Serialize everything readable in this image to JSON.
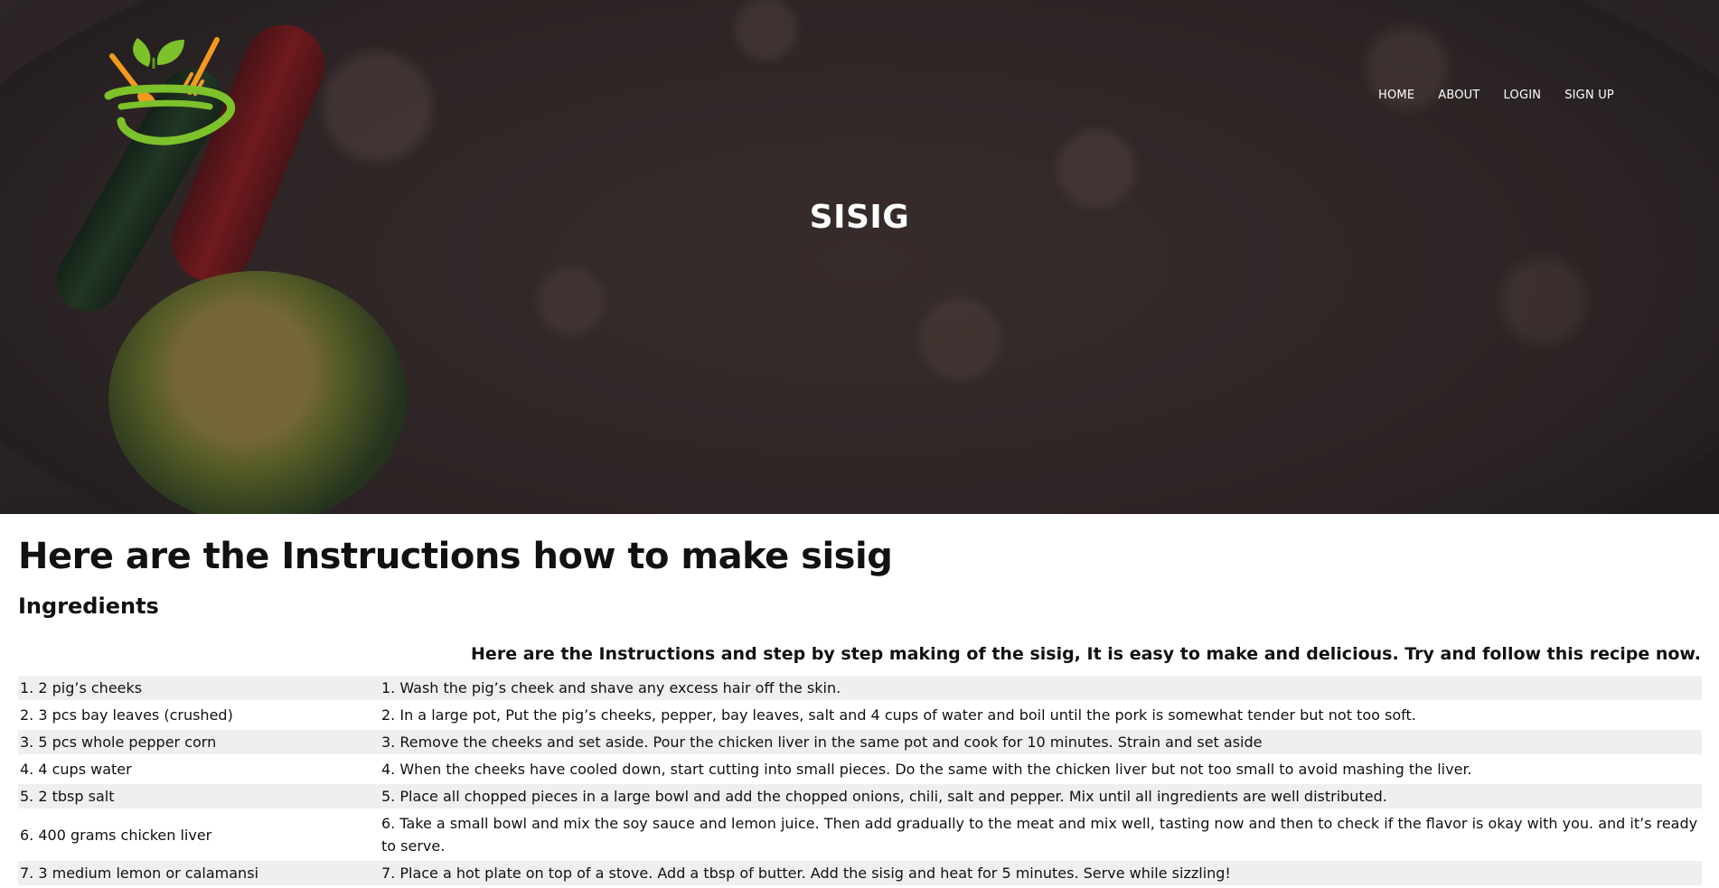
{
  "nav": {
    "items": [
      "HOME",
      "ABOUT",
      "LOGIN",
      "SIGN UP"
    ]
  },
  "hero": {
    "title": "SISIG"
  },
  "page": {
    "heading": "Here are the Instructions how to make sisig",
    "subheading": "Ingredients",
    "lead": "Here are the Instructions and step by step making of the sisig, It is easy to make and delicious. Try and follow this recipe now."
  },
  "table": {
    "rows": [
      {
        "ingredient": "1. 2 pig’s cheeks",
        "step": "1. Wash the pig’s cheek and shave any excess hair off the skin."
      },
      {
        "ingredient": "2. 3 pcs bay leaves (crushed)",
        "step": "2. In a large pot, Put the pig’s cheeks, pepper, bay leaves, salt and 4 cups of water and boil until the pork is somewhat tender but not too soft."
      },
      {
        "ingredient": "3. 5 pcs whole pepper corn",
        "step": "3. Remove the cheeks and set aside. Pour the chicken liver in the same pot and cook for 10 minutes. Strain and set aside"
      },
      {
        "ingredient": "4. 4 cups water",
        "step": "4. When the cheeks have cooled down, start cutting into small pieces. Do the same with the chicken liver but not too small to avoid mashing the liver."
      },
      {
        "ingredient": "5. 2 tbsp salt",
        "step": "5. Place all chopped pieces in a large bowl and add the chopped onions, chili, salt and pepper. Mix until all ingredients are well distributed."
      },
      {
        "ingredient": "6. 400 grams chicken liver",
        "step": "6. Take a small bowl and mix the soy sauce and lemon juice. Then add gradually to the meat and mix well, tasting now and then to check if the flavor is okay with you. and it’s ready to serve."
      },
      {
        "ingredient": "7. 3 medium lemon or calamansi",
        "step": "7. Place a hot plate on top of a stove. Add a tbsp of butter. Add the sisig and heat for 5 minutes. Serve while sizzling!"
      }
    ]
  },
  "icons": {
    "logo": "bowl-with-spoon-fork-and-leaves-logo-icon"
  },
  "colors": {
    "logo_green": "#7dc12b",
    "logo_orange": "#f39a1e"
  }
}
